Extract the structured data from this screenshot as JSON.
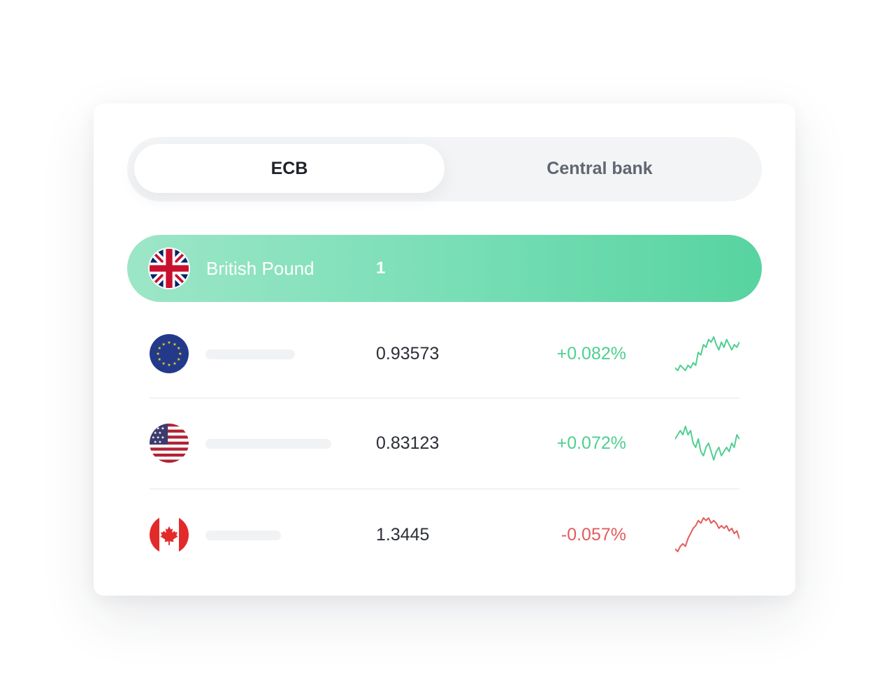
{
  "tabs": {
    "active_label": "ECB",
    "inactive_label": "Central bank"
  },
  "base": {
    "currency": "British Pound",
    "rate": "1",
    "flag_icon": "uk-flag-icon"
  },
  "rows": [
    {
      "flag_icon": "eu-flag-icon",
      "rate": "0.93573",
      "change": "+0.082%",
      "trend": "up",
      "color": "#4fcf8f",
      "sparkline": [
        2,
        1,
        3,
        2,
        1,
        3,
        2,
        4,
        3,
        8,
        7,
        11,
        10,
        13,
        12,
        14,
        11,
        9,
        12,
        10,
        13,
        11,
        9,
        11,
        10,
        12
      ]
    },
    {
      "flag_icon": "us-flag-icon",
      "rate": "0.83123",
      "change": "+0.072%",
      "trend": "up",
      "color": "#4fcf8f",
      "sparkline": [
        8,
        9,
        10,
        9,
        11,
        9,
        10,
        7,
        6,
        8,
        5,
        4,
        6,
        7,
        5,
        3,
        5,
        6,
        4,
        5,
        6,
        5,
        7,
        6,
        9,
        8
      ]
    },
    {
      "flag_icon": "ca-flag-icon",
      "rate": "1.3445",
      "change": "-0.057%",
      "trend": "down",
      "color": "#e25c5c",
      "sparkline": [
        1,
        0,
        2,
        3,
        2,
        5,
        7,
        9,
        10,
        12,
        11,
        13,
        12,
        13,
        11,
        12,
        11,
        9,
        10,
        9,
        10,
        8,
        9,
        7,
        8,
        5
      ]
    }
  ],
  "colors": {
    "accent_green": "#5ad4a2",
    "positive": "#4fcf8f",
    "negative": "#e25c5c"
  }
}
